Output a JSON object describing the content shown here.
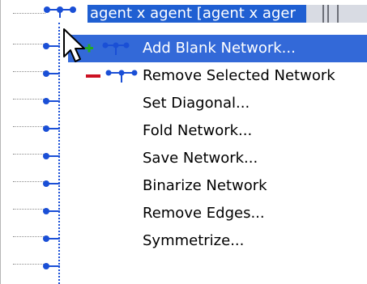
{
  "tree": {
    "selected_label": "agent x agent [agent x ager"
  },
  "menu": {
    "items": [
      {
        "label": "Add Blank Network...",
        "icon": "add-network-icon"
      },
      {
        "label": "Remove Selected Network",
        "icon": "remove-network-icon"
      },
      {
        "label": "Set Diagonal...",
        "icon": ""
      },
      {
        "label": "Fold Network...",
        "icon": ""
      },
      {
        "label": "Save Network...",
        "icon": ""
      },
      {
        "label": "Binarize Network",
        "icon": ""
      },
      {
        "label": "Remove Edges...",
        "icon": ""
      },
      {
        "label": "Symmetrize...",
        "icon": ""
      }
    ],
    "highlighted_index": 0
  },
  "colors": {
    "selection": "#1f5fd2",
    "menu_highlight": "#3369d8",
    "tree_line": "#1a4fd6",
    "plus": "#22aa22",
    "minus": "#cc1122"
  }
}
